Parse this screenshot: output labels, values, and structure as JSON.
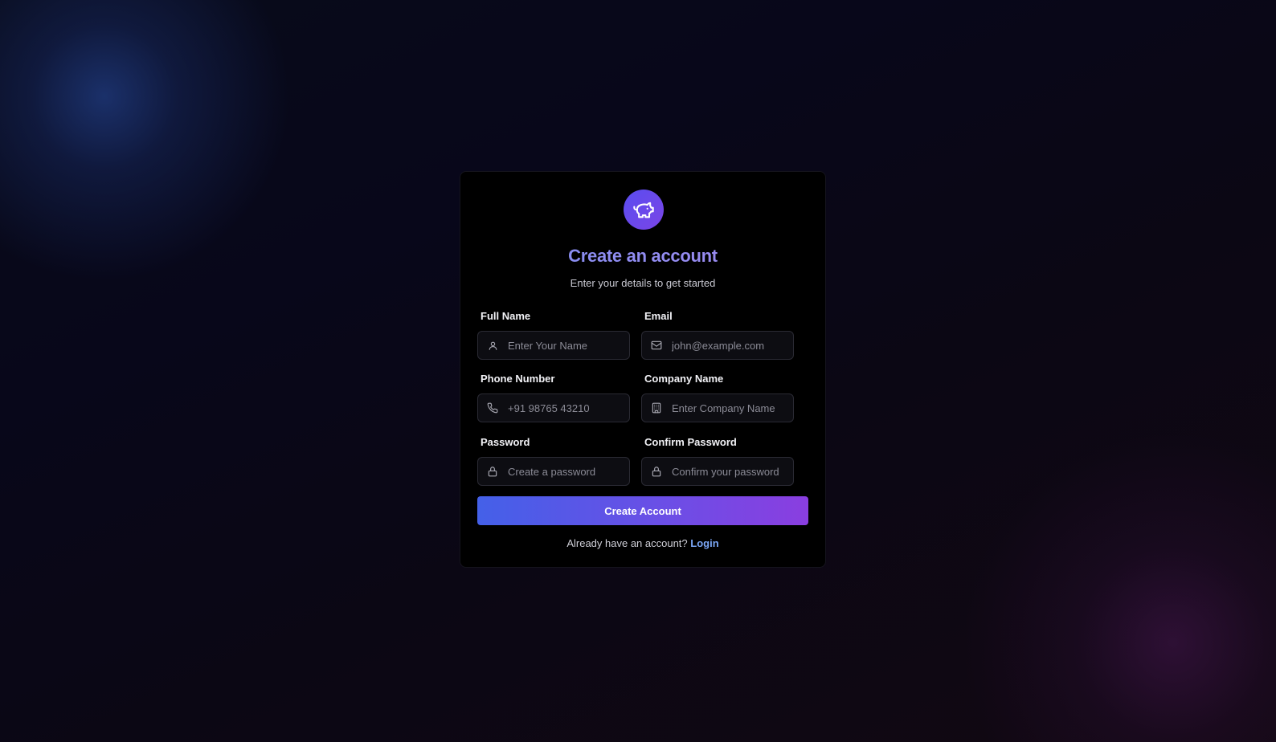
{
  "header": {
    "logo_icon": "piggy-bank-icon",
    "title": "Create an account",
    "subtitle": "Enter your details to get started"
  },
  "form": {
    "full_name": {
      "label": "Full Name",
      "placeholder": "Enter Your Name",
      "value": "",
      "icon": "user-icon"
    },
    "email": {
      "label": "Email",
      "placeholder": "john@example.com",
      "value": "",
      "icon": "mail-icon"
    },
    "phone": {
      "label": "Phone Number",
      "placeholder": "+91 98765 43210",
      "value": "",
      "icon": "phone-icon"
    },
    "company": {
      "label": "Company Name",
      "placeholder": "Enter Company Name",
      "value": "",
      "icon": "building-icon"
    },
    "password": {
      "label": "Password",
      "placeholder": "Create a password",
      "value": "",
      "icon": "lock-icon"
    },
    "confirm_password": {
      "label": "Confirm Password",
      "placeholder": "Confirm your password",
      "value": "",
      "icon": "lock-icon"
    },
    "submit_label": "Create Account"
  },
  "footer": {
    "prompt": "Already have an account?",
    "login_label": "Login"
  },
  "colors": {
    "accent_start": "#4460e8",
    "accent_end": "#8a3ee0",
    "link": "#7aa6f5",
    "card_bg": "#000000",
    "page_bg": "#07060d"
  }
}
